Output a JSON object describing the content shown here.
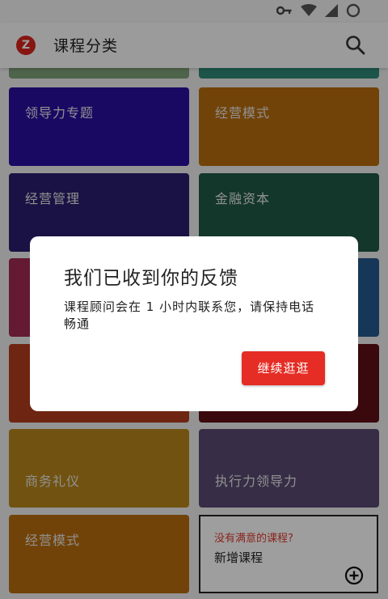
{
  "app_bar": {
    "title": "课程分类",
    "logo_text": "Z",
    "search_icon": "search-icon"
  },
  "status_bar": {
    "icons": [
      "vpn-key-icon",
      "wifi-icon",
      "signal-icon",
      "battery-icon"
    ]
  },
  "categories": [
    {
      "label": "",
      "color": "#7fa27a"
    },
    {
      "label": "",
      "color": "#2f8a78"
    },
    {
      "label": "领导力专题",
      "color": "#2a0fa0"
    },
    {
      "label": "经营模式",
      "color": "#b86d0d"
    },
    {
      "label": "经营管理",
      "color": "#2a1e6e"
    },
    {
      "label": "金融资本",
      "color": "#1f5a45"
    },
    {
      "label": "",
      "color": "#a02a52"
    },
    {
      "label": "",
      "color": "#24598f"
    },
    {
      "label": "",
      "color": "#b23d1d"
    },
    {
      "label": "",
      "color": "#5e1016"
    },
    {
      "label": "商务礼仪",
      "color": "#b7851a"
    },
    {
      "label": "执行力领导力",
      "color": "#5a4a72"
    },
    {
      "label": "经营模式",
      "color": "#b86d0d"
    }
  ],
  "add_course": {
    "hint": "没有满意的课程?",
    "label": "新增课程",
    "icon": "add-circle-icon"
  },
  "dialog": {
    "title": "我们已收到你的反馈",
    "message": "课程顾问会在 1 小时内联系您，请保持电话畅通",
    "button": "继续逛逛"
  }
}
